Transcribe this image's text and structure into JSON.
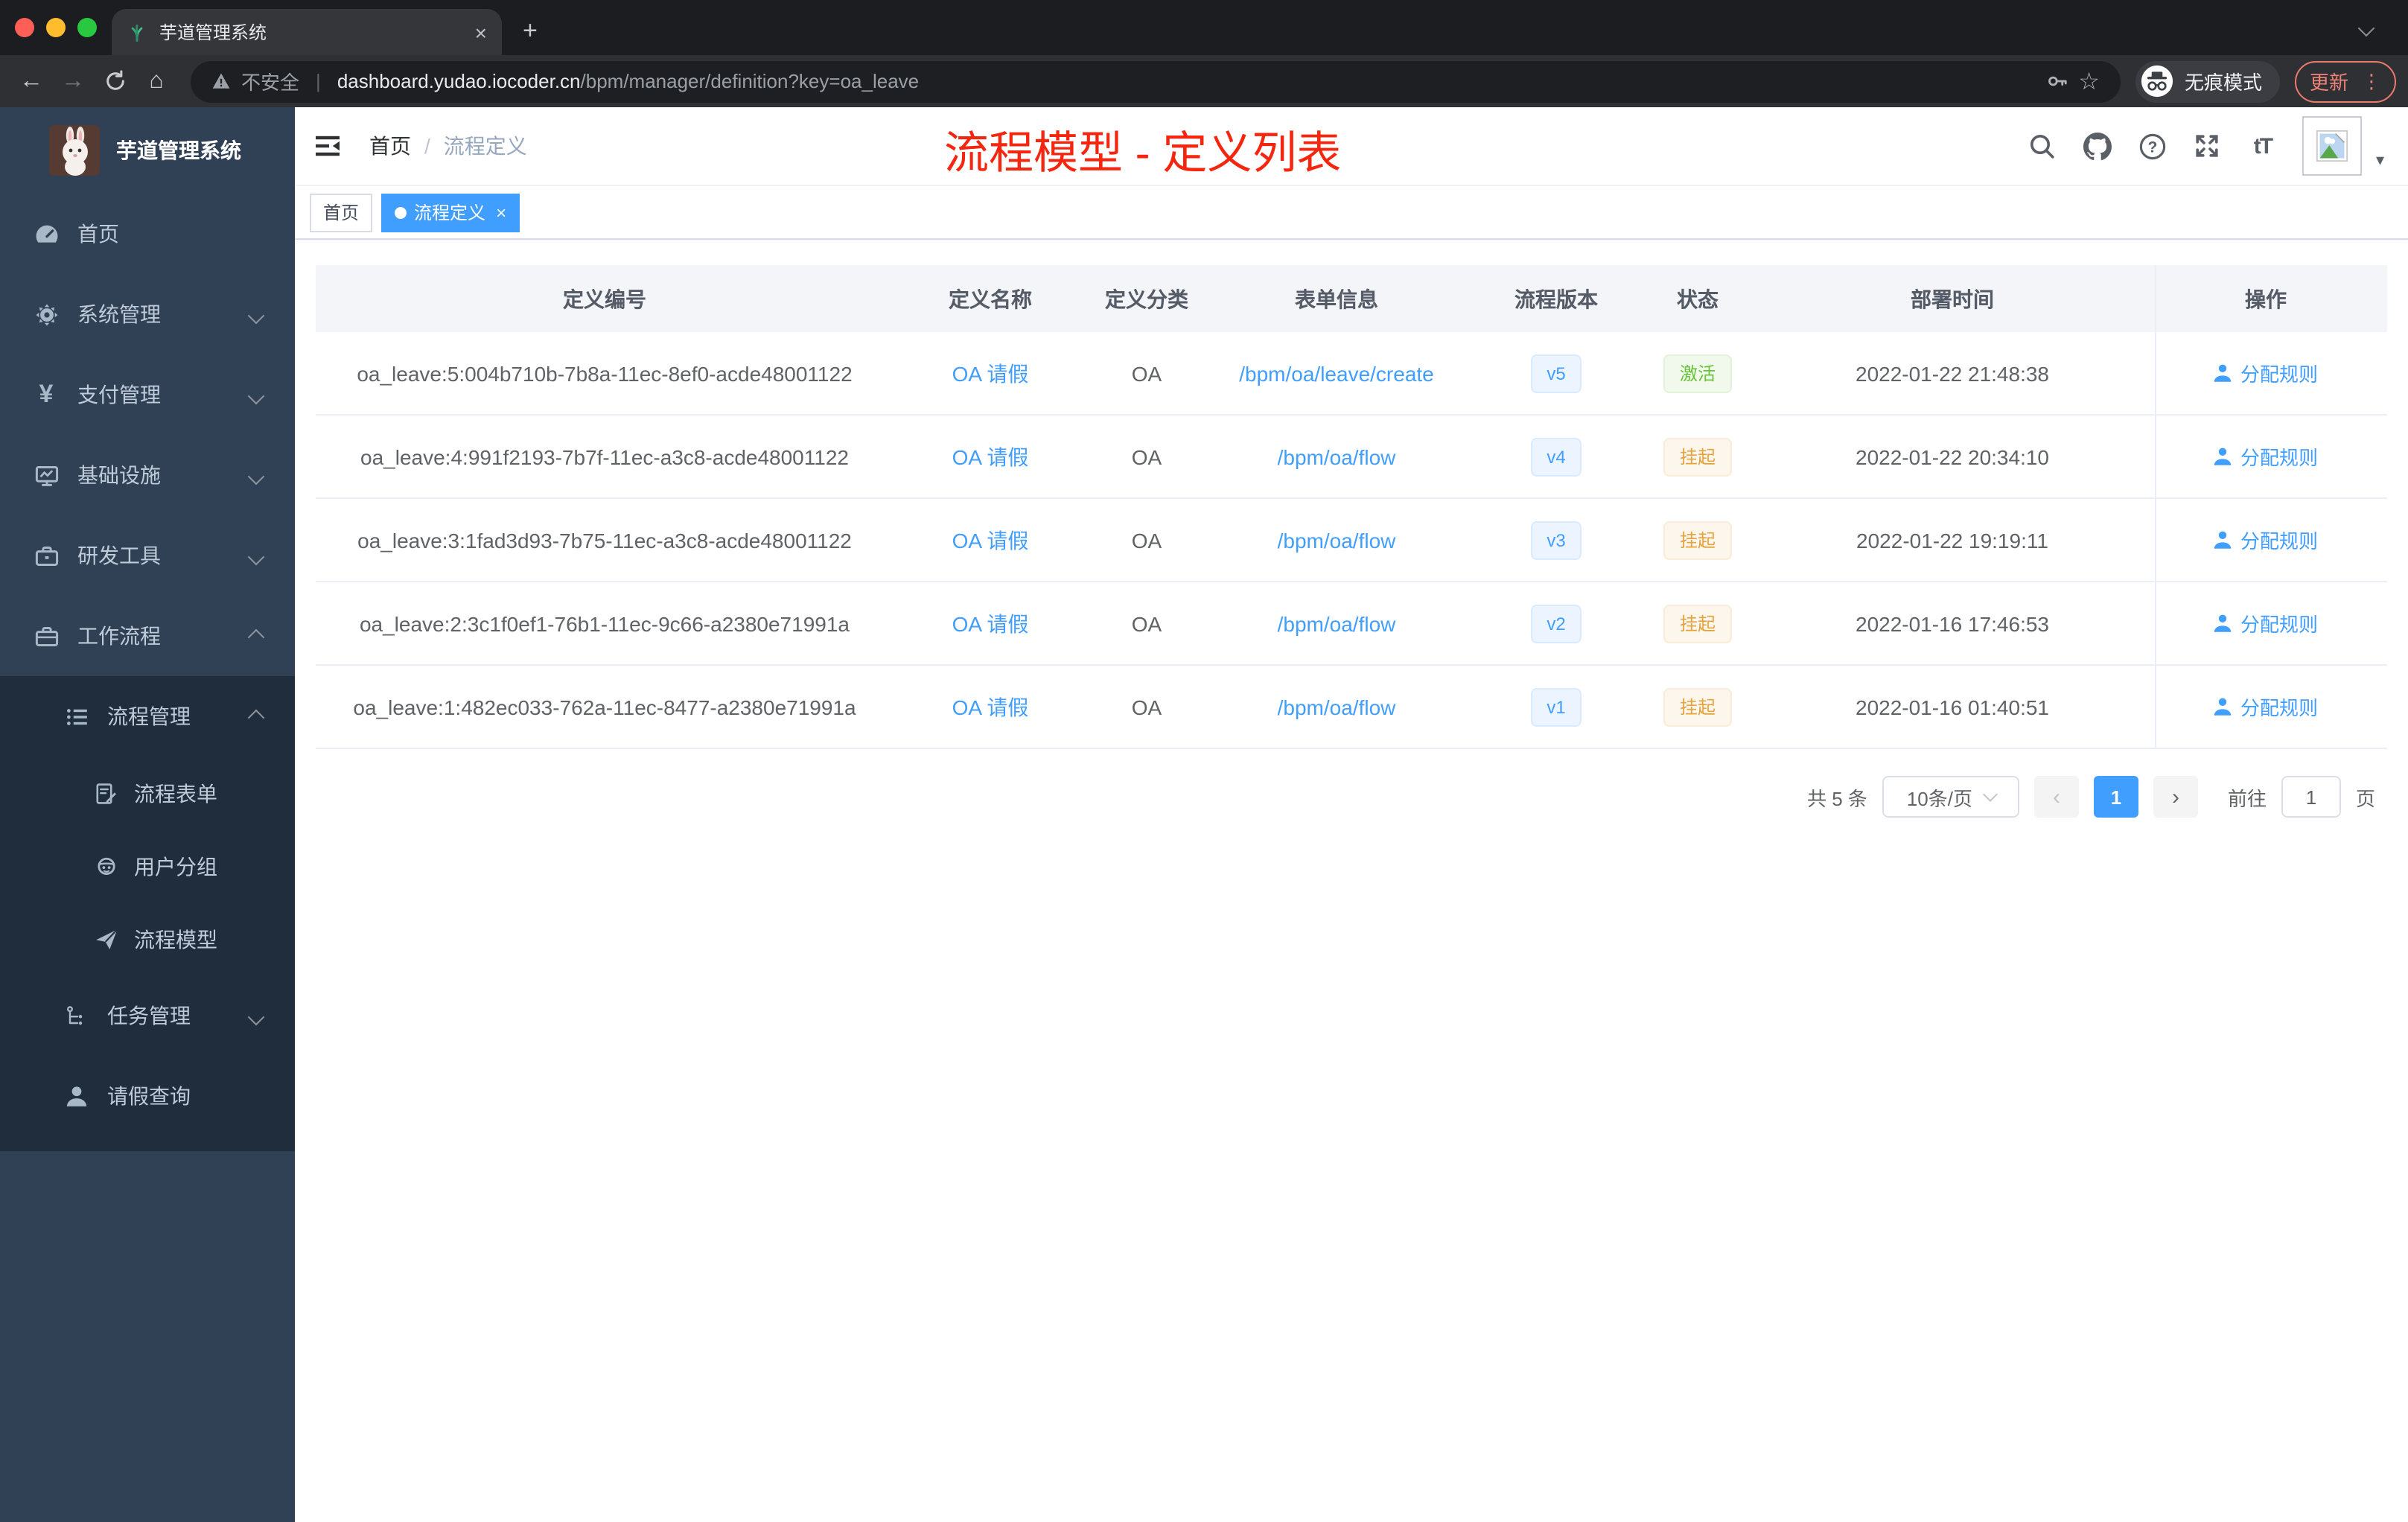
{
  "browser": {
    "tab_title": "芋道管理系统",
    "security_label": "不安全",
    "url_host": "dashboard.yudao.iocoder.cn",
    "url_path": "/bpm/manager/definition?key=oa_leave",
    "incognito_label": "无痕模式",
    "update_label": "更新"
  },
  "glyphs": {
    "back": "←",
    "forward": "→",
    "home": "⌂",
    "star": "☆",
    "kebab": "⋮",
    "close": "×",
    "plus": "+",
    "divider": "|",
    "caret_down": "▾",
    "prev": "‹",
    "next": "›",
    "font_size": "tT"
  },
  "sidebar": {
    "title": "芋道管理系统",
    "items": [
      {
        "label": "首页"
      },
      {
        "label": "系统管理"
      },
      {
        "label": "支付管理"
      },
      {
        "label": "基础设施"
      },
      {
        "label": "研发工具"
      },
      {
        "label": "工作流程"
      },
      {
        "label": "流程管理"
      },
      {
        "label": "流程表单"
      },
      {
        "label": "用户分组"
      },
      {
        "label": "流程模型"
      },
      {
        "label": "任务管理"
      },
      {
        "label": "请假查询"
      }
    ]
  },
  "navbar": {
    "breadcrumb_home": "首页",
    "breadcrumb_sep": "/",
    "breadcrumb_current": "流程定义",
    "annotation": "流程模型 - 定义列表"
  },
  "tags": [
    {
      "label": "首页"
    },
    {
      "label": "流程定义"
    }
  ],
  "table": {
    "columns": [
      "定义编号",
      "定义名称",
      "定义分类",
      "表单信息",
      "流程版本",
      "状态",
      "部署时间",
      "操作"
    ],
    "action_label": "分配规则",
    "rows": [
      {
        "id": "oa_leave:5:004b710b-7b8a-11ec-8ef0-acde48001122",
        "name": "OA 请假",
        "category": "OA",
        "form": "/bpm/oa/leave/create",
        "version": "v5",
        "status": "激活",
        "deploy_time": "2022-01-22 21:48:38",
        "action": "分配规则"
      },
      {
        "id": "oa_leave:4:991f2193-7b7f-11ec-a3c8-acde48001122",
        "name": "OA 请假",
        "category": "OA",
        "form": "/bpm/oa/flow",
        "version": "v4",
        "status": "挂起",
        "deploy_time": "2022-01-22 20:34:10",
        "action": "分配规则"
      },
      {
        "id": "oa_leave:3:1fad3d93-7b75-11ec-a3c8-acde48001122",
        "name": "OA 请假",
        "category": "OA",
        "form": "/bpm/oa/flow",
        "version": "v3",
        "status": "挂起",
        "deploy_time": "2022-01-22 19:19:11",
        "action": "分配规则"
      },
      {
        "id": "oa_leave:2:3c1f0ef1-76b1-11ec-9c66-a2380e71991a",
        "name": "OA 请假",
        "category": "OA",
        "form": "/bpm/oa/flow",
        "version": "v2",
        "status": "挂起",
        "deploy_time": "2022-01-16 17:46:53",
        "action": "分配规则"
      },
      {
        "id": "oa_leave:1:482ec033-762a-11ec-8477-a2380e71991a",
        "name": "OA 请假",
        "category": "OA",
        "form": "/bpm/oa/flow",
        "version": "v1",
        "status": "挂起",
        "deploy_time": "2022-01-16 01:40:51",
        "action": "分配规则"
      }
    ]
  },
  "pagination": {
    "total": "共 5 条",
    "page_size": "10条/页",
    "current_page": "1",
    "goto_prefix": "前往",
    "goto_value": "1",
    "goto_suffix": "页"
  },
  "colors": {
    "accent": "#409eff",
    "annotation_red": "#f5260f",
    "status_active": "#67c23a",
    "status_suspend": "#e6a23c",
    "sidebar_bg": "#304156",
    "submenu_bg": "#1f2d3d"
  }
}
